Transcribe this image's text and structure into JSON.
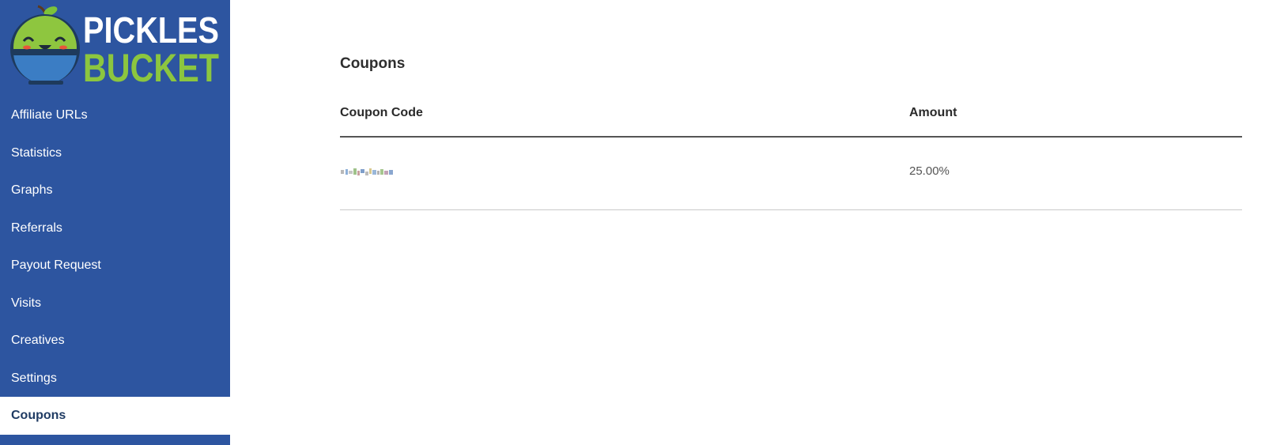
{
  "logo": {
    "line1": "PICKLES",
    "line2": "BUCKET"
  },
  "nav": {
    "items": [
      {
        "label": "Affiliate URLs",
        "active": false
      },
      {
        "label": "Statistics",
        "active": false
      },
      {
        "label": "Graphs",
        "active": false
      },
      {
        "label": "Referrals",
        "active": false
      },
      {
        "label": "Payout Request",
        "active": false
      },
      {
        "label": "Visits",
        "active": false
      },
      {
        "label": "Creatives",
        "active": false
      },
      {
        "label": "Settings",
        "active": false
      },
      {
        "label": "Coupons",
        "active": true
      }
    ]
  },
  "main": {
    "title": "Coupons",
    "table": {
      "headers": {
        "code": "Coupon Code",
        "amount": "Amount"
      },
      "rows": [
        {
          "amount": "25.00%"
        }
      ]
    }
  },
  "colors": {
    "sidebar_bg": "#2d55a0",
    "logo_white": "#ffffff",
    "logo_green": "#8cc63f",
    "active_text": "#1f3b63"
  }
}
